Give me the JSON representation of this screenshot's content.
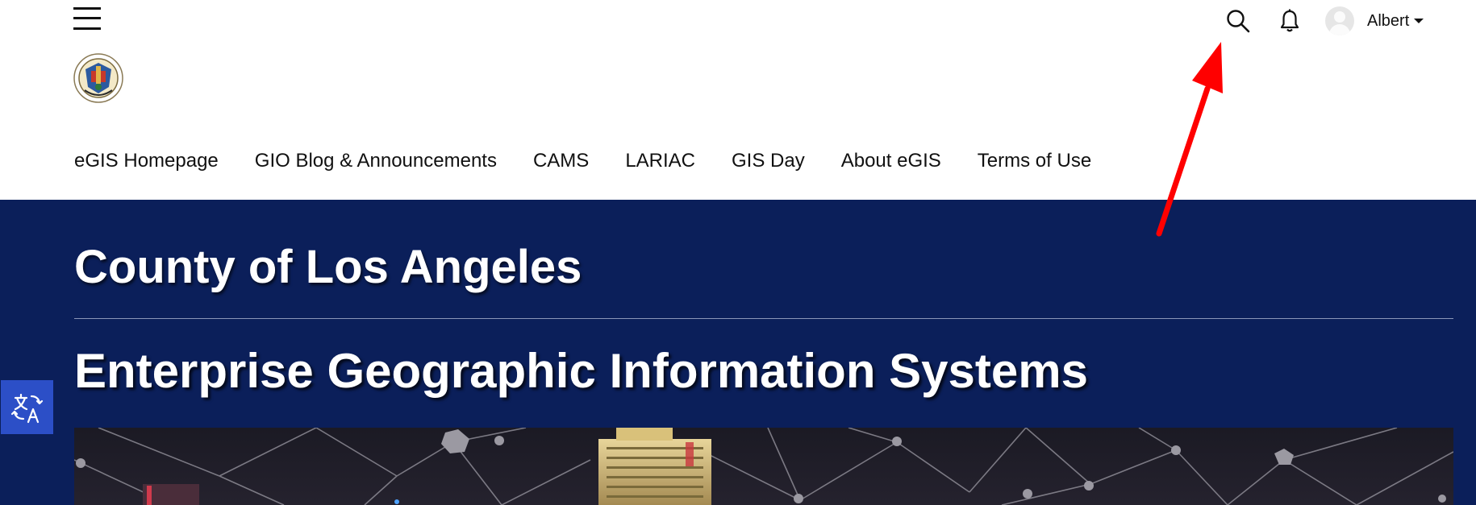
{
  "header": {
    "menu_icon": "hamburger-menu-icon",
    "search_icon": "search-icon",
    "notifications_icon": "bell-icon",
    "user": {
      "name": "Albert",
      "avatar_icon": "user-avatar-icon",
      "dropdown_icon": "caret-down-icon"
    },
    "logo": "county-seal-logo"
  },
  "nav": {
    "items": [
      {
        "label": "eGIS Homepage"
      },
      {
        "label": "GIO Blog & Announcements"
      },
      {
        "label": "CAMS"
      },
      {
        "label": "LARIAC"
      },
      {
        "label": "GIS Day"
      },
      {
        "label": "About eGIS"
      },
      {
        "label": "Terms of Use"
      }
    ]
  },
  "hero": {
    "title": "County of Los Angeles",
    "subtitle": "Enterprise Geographic Information Systems",
    "background_color": "#0b1f5a",
    "image": "night-city-network-image"
  },
  "translate_widget": {
    "icon": "translate-icon",
    "color": "#2c4fc7"
  },
  "annotation": {
    "type": "red-arrow",
    "color": "#ff0000",
    "points_to": "search-icon"
  }
}
